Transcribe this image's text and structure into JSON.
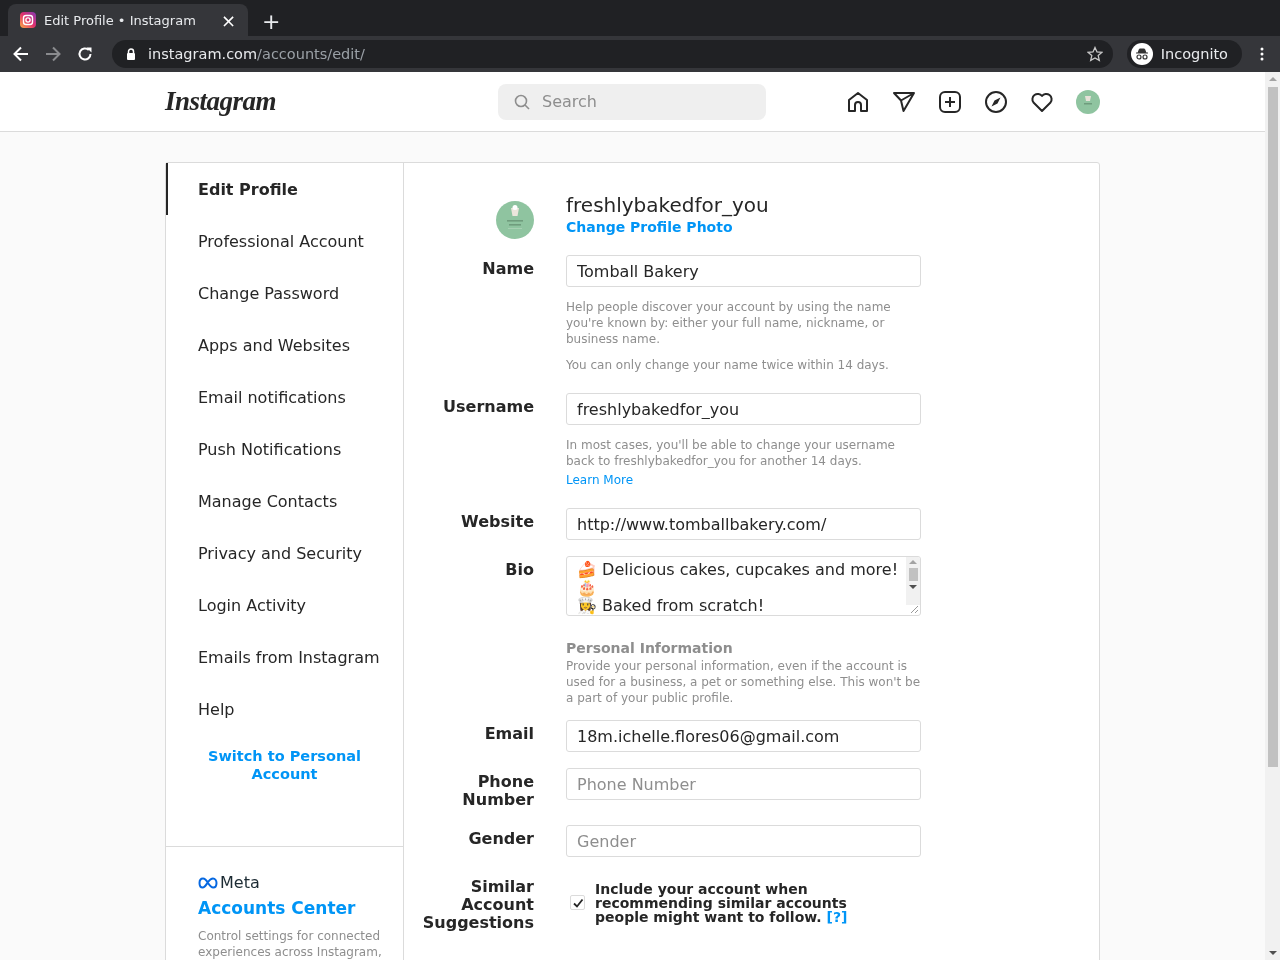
{
  "browser": {
    "tab": {
      "title": "Edit Profile • Instagram",
      "close": "×"
    },
    "new_tab": "+",
    "address": {
      "host": "instagram.com",
      "path": "/accounts/edit/"
    },
    "incognito": "Incognito"
  },
  "header": {
    "logo": "Instagram",
    "search": {
      "placeholder": "Search"
    }
  },
  "sidebar": {
    "items": [
      {
        "label": "Edit Profile",
        "selected": true
      },
      {
        "label": "Professional Account",
        "selected": false
      },
      {
        "label": "Change Password",
        "selected": false
      },
      {
        "label": "Apps and Websites",
        "selected": false
      },
      {
        "label": "Email notifications",
        "selected": false
      },
      {
        "label": "Push Notifications",
        "selected": false
      },
      {
        "label": "Manage Contacts",
        "selected": false
      },
      {
        "label": "Privacy and Security",
        "selected": false
      },
      {
        "label": "Login Activity",
        "selected": false
      },
      {
        "label": "Emails from Instagram",
        "selected": false
      },
      {
        "label": "Help",
        "selected": false
      }
    ],
    "switch_link": "Switch to Personal Account",
    "meta": {
      "brand": "Meta",
      "title": "Accounts Center",
      "description": "Control settings for connected experiences across Instagram,"
    }
  },
  "profile": {
    "username": "freshlybakedfor_you",
    "change_photo": "Change Profile Photo"
  },
  "form": [
    {
      "kind": "input",
      "label": "Name",
      "value": "Tomball Bakery",
      "hints": [
        {
          "text": "Help people discover your account by using the name you're known by: either your full name, nickname, or business name."
        },
        {
          "text": "You can only change your name twice within 14 days."
        }
      ]
    },
    {
      "kind": "input",
      "label": "Username",
      "value": "freshlybakedfor_you",
      "hints": [
        {
          "text": "In most cases, you'll be able to change your username back to freshlybakedfor_you for another 14 days.",
          "link": "Learn More"
        }
      ]
    },
    {
      "kind": "input",
      "label": "Website",
      "value": "http://www.tomballbakery.com/"
    },
    {
      "kind": "textarea",
      "label": "Bio",
      "value": "🍰 Delicious cakes, cupcakes and more!\n🎂\n👩‍🍳 Baked from scratch!"
    },
    {
      "kind": "section",
      "title": "Personal Information",
      "description": "Provide your personal information, even if the account is used for a business, a pet or something else. This won't be a part of your public profile."
    },
    {
      "kind": "input",
      "label": "Email",
      "value": "18m.ichelle.flores06@gmail.com"
    },
    {
      "kind": "input",
      "label": "Phone Number",
      "placeholder": "Phone Number"
    },
    {
      "kind": "input",
      "label": "Gender",
      "placeholder": "Gender"
    },
    {
      "kind": "checkbox",
      "label": "Similar Account Suggestions",
      "text": "Include your account when recommending similar accounts people might want to follow.",
      "link": "[?]",
      "checked": true
    }
  ]
}
